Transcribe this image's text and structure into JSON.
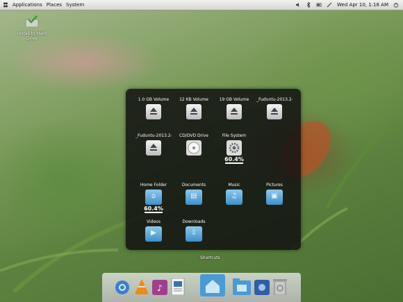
{
  "panel": {
    "menus": [
      "Applications",
      "Places",
      "System"
    ],
    "clock": "Wed Apr 10,  1:18 AM"
  },
  "desktop": {
    "icons": [
      {
        "label": "Install to Hard Drive"
      }
    ]
  },
  "stack": {
    "devices": [
      {
        "label": "1.0 GB Volume"
      },
      {
        "label": "12 KB Volume"
      },
      {
        "label": "19 GB Volume"
      },
      {
        "label": "_Fuduntu-2013.2-..."
      },
      {
        "label": "_Fuduntu-2013.2-...1"
      },
      {
        "label": "CD/DVD Drive"
      },
      {
        "label": "File System",
        "usage": "60.4%"
      }
    ],
    "places": [
      {
        "label": "Home Folder",
        "usage": "60.4%"
      },
      {
        "label": "Documents"
      },
      {
        "label": "Music"
      },
      {
        "label": "Pictures"
      },
      {
        "label": "Videos"
      },
      {
        "label": "Downloads"
      }
    ]
  },
  "dock": {
    "tooltip": "Shortcuts"
  },
  "colors": {
    "folder_blue": "#3f8fc9",
    "popup_bg": "#121212"
  }
}
